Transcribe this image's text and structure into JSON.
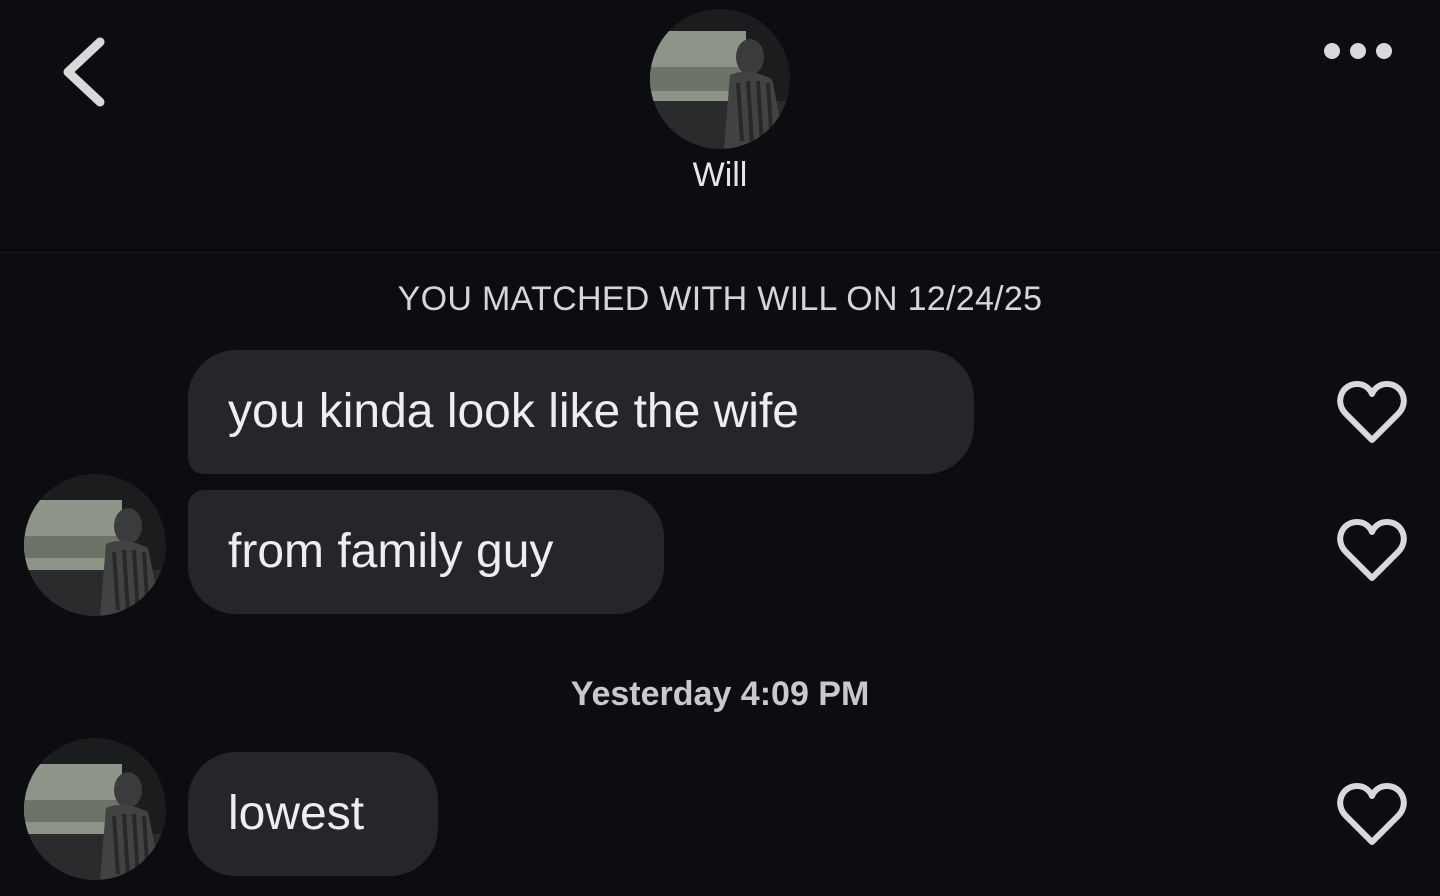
{
  "header": {
    "back_icon": "chevron-left-icon",
    "more_icon": "more-horizontal-icon",
    "contact_name": "Will"
  },
  "conversation": {
    "match_note": "YOU MATCHED WITH WILL ON 12/24/25",
    "messages": [
      {
        "text": "you kinda look like the wife",
        "liked": false
      },
      {
        "text": "from family guy",
        "liked": false
      },
      {
        "text": "lowest",
        "liked": false
      }
    ],
    "timestamp": "Yesterday 4:09 PM"
  },
  "colors": {
    "background": "#0c0d10",
    "bubble": "#25262b",
    "text": "#eeeef0",
    "icon": "#d9d9dc"
  }
}
